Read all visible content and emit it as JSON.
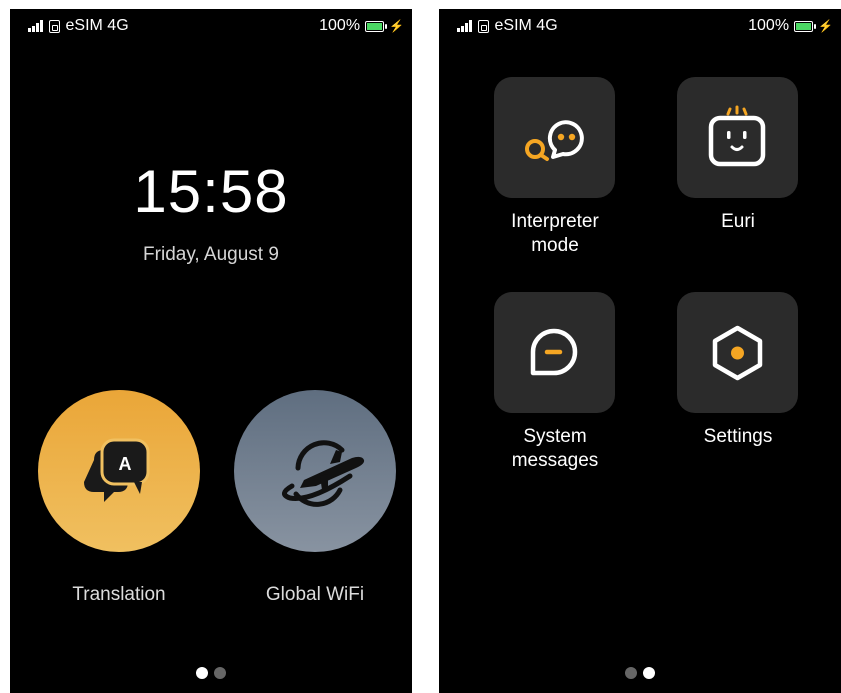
{
  "status_bar": {
    "carrier": "eSIM 4G",
    "battery_text": "100%",
    "battery_color": "#4cd964"
  },
  "lock_screen": {
    "time": "15:58",
    "date": "Friday, August 9",
    "shortcuts": [
      {
        "label": "Translation",
        "icon": "translation-icon",
        "glyph": "A",
        "color": "#eaa638"
      },
      {
        "label": "Global WiFi",
        "icon": "airplane-globe-icon",
        "color": "#6b7a8c"
      }
    ],
    "page_indicator": {
      "pages": 2,
      "current": 1
    }
  },
  "app_screen": {
    "apps": [
      {
        "label_lines": [
          "Interpreter",
          "mode"
        ],
        "icon": "interpreter-chat-icon"
      },
      {
        "label_lines": [
          "Euri"
        ],
        "icon": "euri-robot-icon"
      },
      {
        "label_lines": [
          "System",
          "messages"
        ],
        "icon": "message-bubble-icon"
      },
      {
        "label_lines": [
          "Settings"
        ],
        "icon": "hexagon-settings-icon"
      }
    ],
    "page_indicator": {
      "pages": 2,
      "current": 2
    }
  },
  "accent_color": "#f5a623"
}
